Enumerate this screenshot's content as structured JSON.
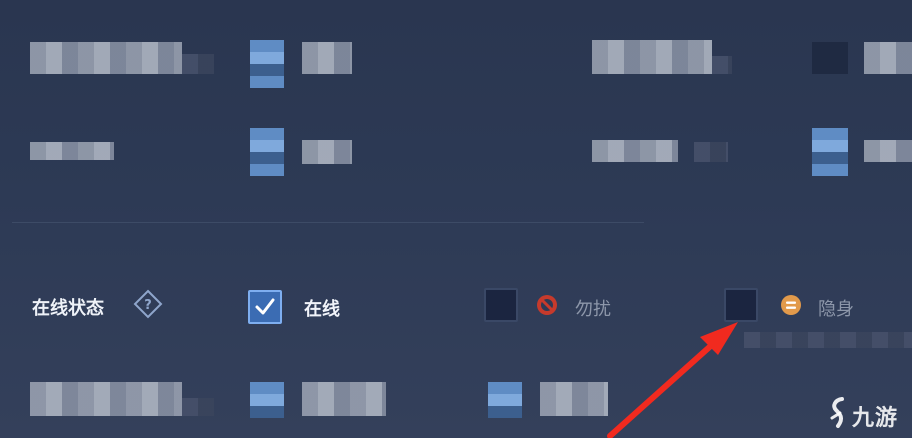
{
  "settings": {
    "online_status": {
      "label": "在线状态",
      "help_icon": "question-diamond-icon",
      "options": [
        {
          "label": "在线",
          "checked": true,
          "icon": "checkmark-icon"
        },
        {
          "label": "勿扰",
          "checked": false,
          "icon": "do-not-disturb-icon"
        },
        {
          "label": "隐身",
          "checked": false,
          "icon": "invisible-icon"
        }
      ]
    }
  },
  "watermark": {
    "text": "九游",
    "logo": "jiuyou-logo"
  },
  "colors": {
    "background": "#2d3a55",
    "checked_fill": "#3b6cb3",
    "dnd_red": "#c63a2c",
    "invisible_orange": "#e29a4b",
    "arrow_red": "#f12a1f"
  }
}
